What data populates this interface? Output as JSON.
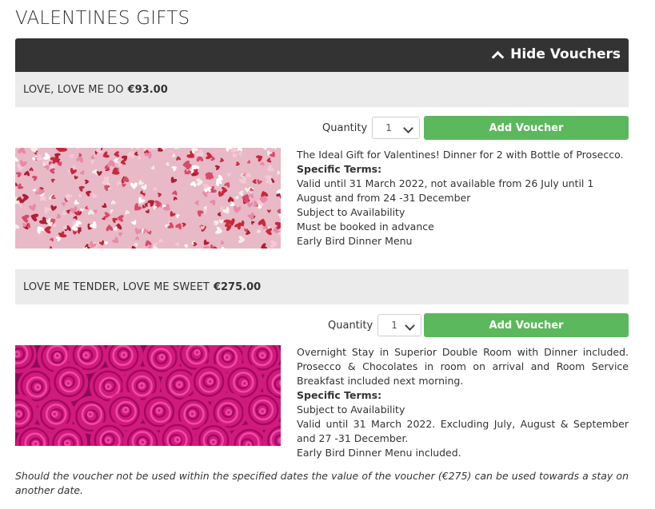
{
  "page": {
    "title": "VALENTINES GIFTS"
  },
  "toggle": {
    "label": "Hide Vouchers",
    "icon": "chevron-up-icon"
  },
  "vouchers": [
    {
      "name": "LOVE, LOVE ME DO",
      "price": "€93.00",
      "quantity_label": "Quantity",
      "quantity_value": "1",
      "button_label": "Add Voucher",
      "description": "The Ideal Gift for Valentines! Dinner for 2 with Bottle of Prosecco.",
      "terms_title": "Specific Terms:",
      "terms": [
        "Valid until 31 March 2022, not available from 26 July until 1 August and from 24 -31 December",
        "Subject to Availability",
        "Must be booked in advance",
        "Early Bird Dinner Menu"
      ]
    },
    {
      "name": "LOVE ME TENDER, LOVE ME SWEET",
      "price": "€275.00",
      "quantity_label": "Quantity",
      "quantity_value": "1",
      "button_label": "Add Voucher",
      "description": "Overnight Stay in Superior Double Room with Dinner included. Prosecco & Chocolates in room on arrival and Room Service Breakfast included next morning.",
      "terms_title": "Specific Terms:",
      "terms": [
        "Subject to Availability",
        "Valid until 31 March 2022. Excluding July, August & September and 27 -31 December.",
        "Early Bird Dinner Menu included."
      ]
    }
  ],
  "footnote": "Should the voucher not be used within the specified dates the value of the voucher (€275) can be used towards a stay on another date.",
  "colors": {
    "bar": "#333333",
    "header_bg": "#ebebeb",
    "button": "#5cb85c"
  }
}
